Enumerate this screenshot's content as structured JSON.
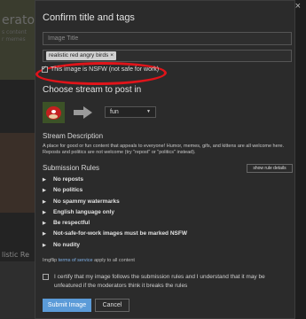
{
  "background": {
    "partial_title": "erator",
    "partial_line1": "s content",
    "partial_line2": "r memes",
    "partial_caption": "listic Re"
  },
  "modal": {
    "title": "Confirm title and tags",
    "title_input": {
      "value": "",
      "placeholder": "Image Title"
    },
    "tags": [
      {
        "label": "realistic red angry birds",
        "remove": "×"
      }
    ],
    "nsfw": {
      "checked": true,
      "label": "This image is NSFW (not safe for work)"
    },
    "stream_heading": "Choose stream to post in",
    "stream_select": {
      "value": "fun"
    },
    "stream_description": {
      "title": "Stream Description",
      "text": "A place for good or fun content that appeals to everyone! Humor, memes, gifs, and kittens are all welcome here. Reposts and politics are not welcome (try \"repost\" or \"politics\" instead)."
    },
    "submission_rules": {
      "title": "Submission Rules",
      "show_details_label": "show rule details",
      "rules": [
        "No reposts",
        "No politics",
        "No spammy watermarks",
        "English language only",
        "Be respectful",
        "Not-safe-for-work images must be marked NSFW",
        "No nudity"
      ]
    },
    "tos": {
      "prefix": "Imgflip",
      "link": "terms of service",
      "suffix": "apply to all content"
    },
    "certify": {
      "checked": false,
      "text": "I certify that my image follows the submission rules and I understand that it may be unfeatured if the moderators think it breaks the rules"
    },
    "buttons": {
      "submit": "Submit Image",
      "cancel": "Cancel"
    },
    "close_symbol": "×"
  },
  "colors": {
    "modal_bg": "#2b2b2b",
    "accent": "#5b9bd8",
    "highlight": "#e0141a",
    "link": "#7fb1e8"
  },
  "icons": {
    "close": "close-icon",
    "stream_arrow": "arrow-right-icon",
    "select_caret": "chevron-down-icon",
    "rule_caret": "chevron-right-icon",
    "nsfw_check": "checkmark-icon"
  }
}
